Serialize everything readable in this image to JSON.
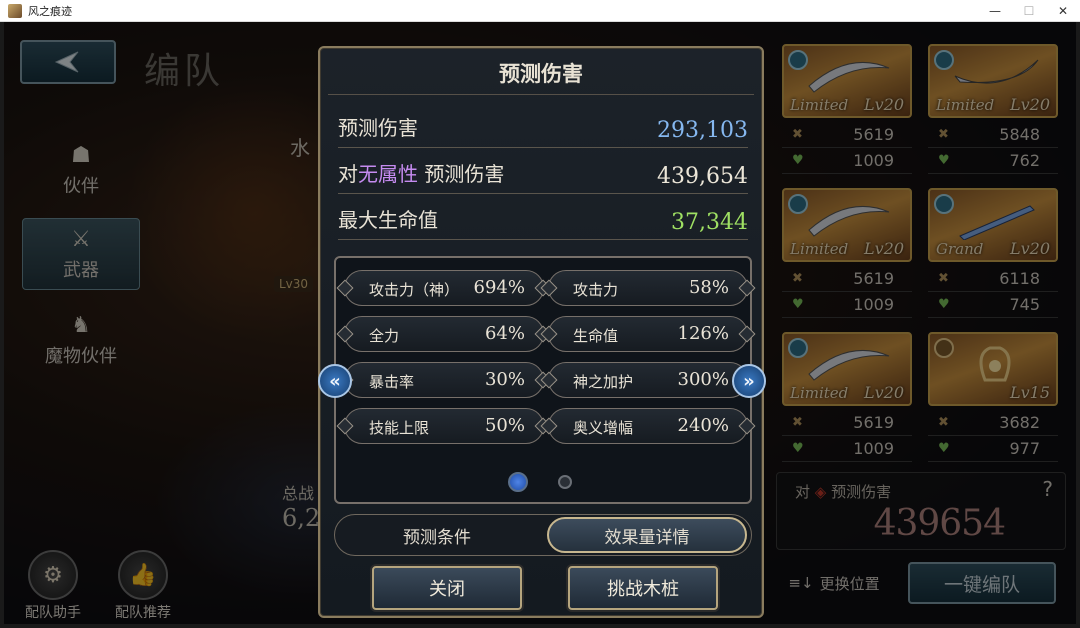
{
  "window": {
    "title": "风之痕迹",
    "minimize": "—",
    "maximize": "☐",
    "close": "✕"
  },
  "header": {
    "page_title": "编队",
    "back_icon": "back-arrow-icon"
  },
  "sidebar": {
    "items": [
      {
        "label": "伙伴",
        "icon": "character-icon"
      },
      {
        "label": "武器",
        "icon": "crossed-swords-icon",
        "active": true
      },
      {
        "label": "魔物伙伴",
        "icon": "monster-icon"
      }
    ]
  },
  "background": {
    "level_tag": "Lv30",
    "partial_total_label": "总战",
    "partial_total_value": "6,2",
    "partial_water": "水"
  },
  "assist": {
    "left_label": "配队助手",
    "right_label": "配队推荐"
  },
  "weapons": [
    {
      "rarity": "Limited",
      "level": "Lv20",
      "atk": "5619",
      "hp": "1009"
    },
    {
      "rarity": "Limited",
      "level": "Lv20",
      "atk": "5848",
      "hp": "762"
    },
    {
      "rarity": "Limited",
      "level": "Lv20",
      "atk": "5619",
      "hp": "1009"
    },
    {
      "rarity": "Grand",
      "level": "Lv20",
      "atk": "6118",
      "hp": "745"
    },
    {
      "rarity": "Limited",
      "level": "Lv20",
      "atk": "5619",
      "hp": "1009"
    },
    {
      "rarity": "",
      "level": "Lv15",
      "atk": "3682",
      "hp": "977"
    }
  ],
  "damage_box": {
    "prefix": "对",
    "label": "预测伤害",
    "help": "?",
    "value": "439654"
  },
  "swap_button": {
    "label": "更换位置"
  },
  "one_key_button": {
    "label": "一键编队"
  },
  "modal": {
    "title": "预测伤害",
    "rows": [
      {
        "label": "预测伤害",
        "value": "293,103",
        "color": "#86b8f0"
      },
      {
        "label_prefix": "对",
        "label_highlight": "无属性",
        "label_suffix": " 预测伤害",
        "value": "439,654",
        "color": "#ece6d8",
        "highlight_color": "#c58bf0"
      },
      {
        "label": "最大生命值",
        "value": "37,344",
        "color": "#9fe063"
      }
    ],
    "stats": [
      {
        "label": "攻击力（神）",
        "value": "694%"
      },
      {
        "label": "攻击力",
        "value": "58%"
      },
      {
        "label": "全力",
        "value": "64%"
      },
      {
        "label": "生命值",
        "value": "126%"
      },
      {
        "label": "暴击率",
        "value": "30%"
      },
      {
        "label": "神之加护",
        "value": "300%"
      },
      {
        "label": "技能上限",
        "value": "50%"
      },
      {
        "label": "奥义增幅",
        "value": "240%"
      }
    ],
    "page_indicator": {
      "current": 1,
      "total": 2
    },
    "prev_arrow": "«",
    "next_arrow": "»",
    "tabs": [
      {
        "label": "预测条件",
        "selected": false
      },
      {
        "label": "效果量详情",
        "selected": true
      }
    ],
    "close_button": "关闭",
    "challenge_button": "挑战木桩"
  }
}
